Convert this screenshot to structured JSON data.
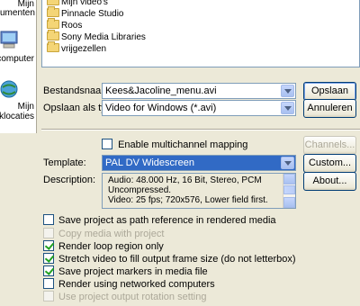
{
  "places": [
    {
      "label_lines": [
        "Mijn",
        "umenten"
      ],
      "icon": "my-documents-icon"
    },
    {
      "label_lines": [
        "computer"
      ],
      "icon": "my-computer-icon"
    },
    {
      "label_lines": [
        "Mijn",
        "eklocaties"
      ],
      "icon": "network-places-icon"
    }
  ],
  "files": [
    "Mijn video's",
    "Pinnacle Studio",
    "Roos",
    "Sony Media Libraries",
    "vrijgezellen"
  ],
  "filename": {
    "label": "Bestandsnaam:",
    "value": "Kees&Jacoline_menu.avi"
  },
  "savetype": {
    "label": "Opslaan als type:",
    "value": "Video for Windows (*.avi)"
  },
  "buttons": {
    "save": "Opslaan",
    "cancel": "Annuleren",
    "channels": "Channels...",
    "custom": "Custom...",
    "about": "About..."
  },
  "multichannel": {
    "label": "Enable multichannel mapping",
    "checked": false
  },
  "template": {
    "label": "Template:",
    "value": "PAL DV Widescreen"
  },
  "description": {
    "label": "Description:",
    "lines": [
      "Audio: 48.000 Hz, 16 Bit, Stereo, PCM",
      "Uncompressed.",
      "Video: 25 fps; 720x576, Lower field first."
    ]
  },
  "options": [
    {
      "label": "Save project as path reference in rendered media",
      "checked": false,
      "disabled": false
    },
    {
      "label": "Copy media with project",
      "checked": false,
      "disabled": true
    },
    {
      "label": "Render loop region only",
      "checked": true,
      "disabled": false
    },
    {
      "label": "Stretch video to fill output frame size (do not letterbox)",
      "checked": true,
      "disabled": false
    },
    {
      "label": "Save project markers in media file",
      "checked": true,
      "disabled": false
    },
    {
      "label": "Render using networked computers",
      "checked": false,
      "disabled": false
    },
    {
      "label": "Use project output rotation setting",
      "checked": false,
      "disabled": true
    }
  ],
  "colors": {
    "selection": "#316ac5",
    "window_bg": "#ece9d8"
  }
}
